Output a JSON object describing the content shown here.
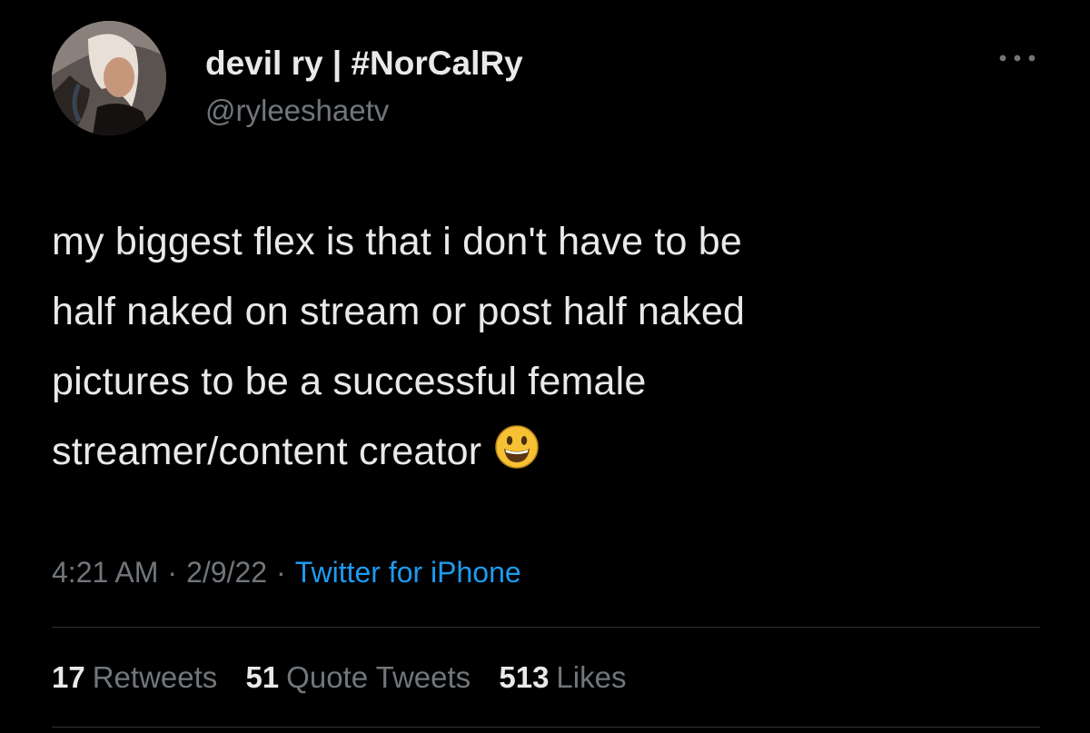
{
  "author": {
    "display_name": "devil ry | #NorCalRy",
    "handle": "@ryleeshaetv"
  },
  "tweet": {
    "text": "my biggest flex is that i don't have to be\nhalf naked on stream or post half naked\npictures to be a successful female\nstreamer/content creator",
    "emoji": "smiling-face-emoji",
    "time": "4:21 AM",
    "date": "2/9/22",
    "separator": "·",
    "source": "Twitter for iPhone"
  },
  "stats": {
    "retweets_count": "17",
    "retweets_label": "Retweets",
    "quotes_count": "51",
    "quotes_label": "Quote Tweets",
    "likes_count": "513",
    "likes_label": "Likes"
  },
  "colors": {
    "background": "#000000",
    "primary_text": "#e7e9ea",
    "secondary_text": "#71767b",
    "link": "#1d9bf0",
    "divider": "#2f3336"
  }
}
